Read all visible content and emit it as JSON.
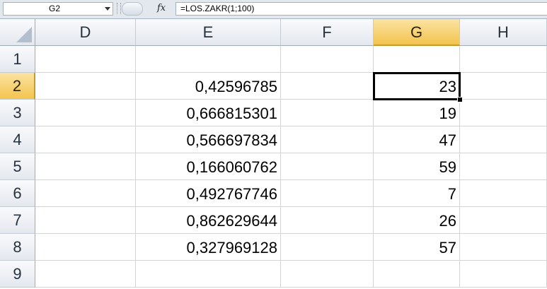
{
  "formula_bar": {
    "name_box": "G2",
    "fx_label": "fx",
    "formula": "=LOS.ZAKR(1;100)"
  },
  "columns": [
    "D",
    "E",
    "F",
    "G",
    "H"
  ],
  "active_column": "G",
  "rows": [
    "1",
    "2",
    "3",
    "4",
    "5",
    "6",
    "7",
    "8",
    "9"
  ],
  "active_row": "2",
  "cells": {
    "E": [
      "",
      "0,42596785",
      "0,666815301",
      "0,566697834",
      "0,166060762",
      "0,492767746",
      "0,862629644",
      "0,327969128",
      ""
    ],
    "G": [
      "",
      "23",
      "19",
      "47",
      "59",
      "7",
      "26",
      "57",
      ""
    ]
  },
  "selected_cell": "G2",
  "colors": {
    "active_header": "#f3c44e",
    "header": "#e4e8ee",
    "gridline": "#d4d4d4"
  }
}
